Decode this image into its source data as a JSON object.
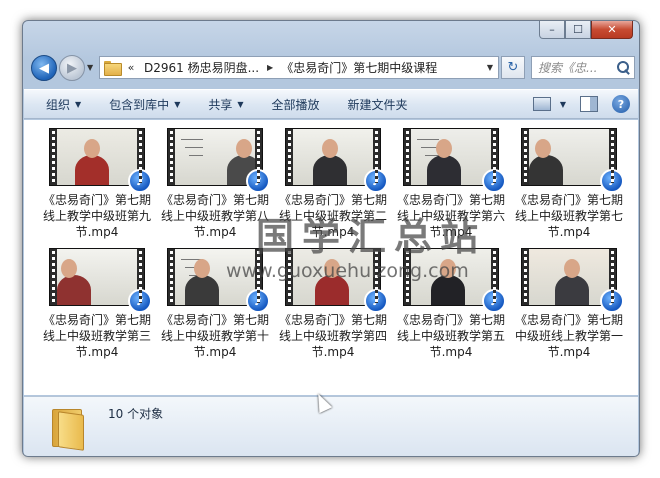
{
  "window": {
    "caption": {
      "minimize": "–",
      "maximize": "☐",
      "close": "✕"
    }
  },
  "nav": {
    "back": "◀",
    "forward": "▶",
    "dropdown": "▼",
    "address": {
      "overflow": "«",
      "crumbs": [
        "D2961 杨忠易阴盘...",
        "《忠易奇门》第七期中级课程"
      ],
      "separator": "▶",
      "dropdown": "▼"
    },
    "refresh": "↻",
    "search_placeholder": "搜索《忠..."
  },
  "commands": [
    {
      "label": "组织",
      "arrow": "▼"
    },
    {
      "label": "包含到库中",
      "arrow": "▼"
    },
    {
      "label": "共享",
      "arrow": "▼"
    },
    {
      "label": "全部播放",
      "arrow": ""
    },
    {
      "label": "新建文件夹",
      "arrow": ""
    }
  ],
  "command_right": {
    "view_arrow": "▼",
    "help": "?"
  },
  "files": [
    {
      "name": "《忠易奇门》第七期线上教学中级班第九节.mp4",
      "scene": "red"
    },
    {
      "name": "《忠易奇门》第七期线上中级班教学第八节.mp4",
      "scene": "board"
    },
    {
      "name": "《忠易奇门》第七期线上中级班教学第二节.mp4",
      "scene": "dark"
    },
    {
      "name": "《忠易奇门》第七期线上中级班教学第六节.mp4",
      "scene": "suit"
    },
    {
      "name": "《忠易奇门》第七期线上中级班教学第七节.mp4",
      "scene": "side"
    },
    {
      "name": "《忠易奇门》第七期线上中级班教学第三节.mp4",
      "scene": "side-red"
    },
    {
      "name": "《忠易奇门》第七期线上中级班教学第十节.mp4",
      "scene": "small"
    },
    {
      "name": "《忠易奇门》第七期线上中级班教学第四节.mp4",
      "scene": "red-center"
    },
    {
      "name": "《忠易奇门》第七期线上中级班教学第五节.mp4",
      "scene": "suit-wide"
    },
    {
      "name": "《忠易奇门》第七期中级班线上教学第一节.mp4",
      "scene": "close"
    }
  ],
  "media_badge_glyph": "♪",
  "watermark": {
    "title": "国学汇总站",
    "url": "www.guoxuehuizong.com"
  },
  "details": {
    "count": "10 个对象"
  },
  "colors": {
    "accent": "#1f63b8",
    "command_text": "#1e395b"
  }
}
